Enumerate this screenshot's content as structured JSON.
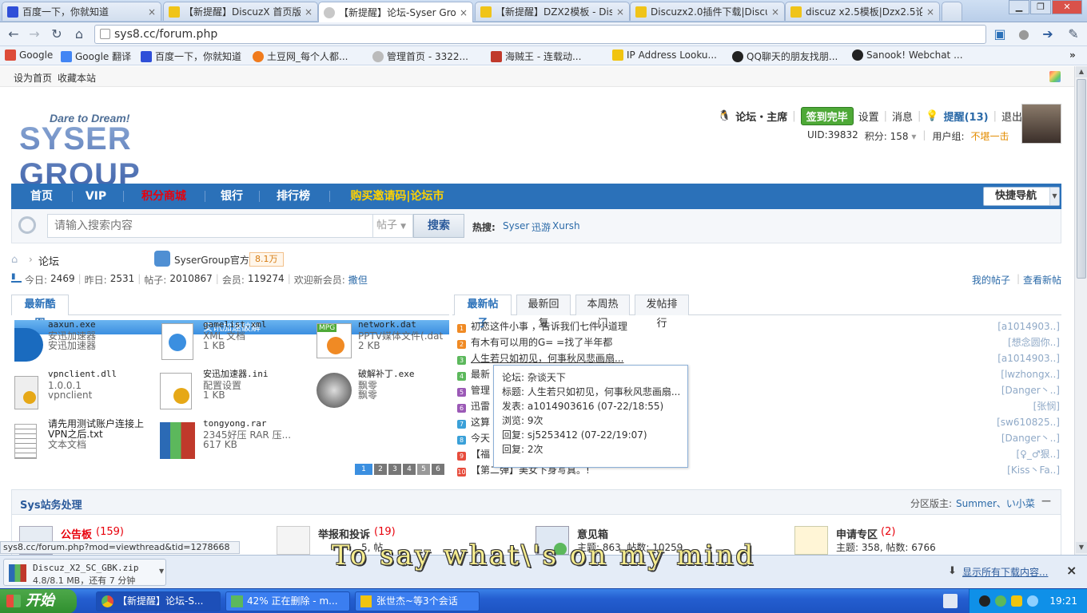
{
  "browser": {
    "tabs": [
      {
        "title": "百度一下，你就知道"
      },
      {
        "title": "【新提醒】DiscuzX 首页版..."
      },
      {
        "title": "【新提醒】论坛-Syser Gro..."
      },
      {
        "title": "【新提醒】DZX2模板 - Dis..."
      },
      {
        "title": "Discuzx2.0插件下载|Discu..."
      },
      {
        "title": "discuz x2.5模板|Dzx2.5论..."
      }
    ],
    "close_glyph": "×",
    "url": "sys8.cc/forum.php",
    "bookmarks": [
      "Google",
      "Google 翻译",
      "百度一下，你就知道",
      "土豆网_每个人都...",
      "管理首页 - 3322...",
      "海贼王 - 连载动...",
      "IP Address Looku...",
      "QQ聊天的朋友找朋...",
      "Sanook! Webchat ..."
    ],
    "status_url": "sys8.cc/forum.php?mod=viewthread&tid=1278668"
  },
  "site": {
    "top_links": [
      "设为首页",
      "收藏本站"
    ],
    "logo_tagline": "Dare to Dream!",
    "logo_name": "SYSER GROUP",
    "user_bar": {
      "forum_home": "论坛・主席",
      "signin": "签到完毕",
      "settings": "设置",
      "messages": "消息",
      "reminders": "提醒(13)",
      "logout": "退出",
      "uid": "UID:39832",
      "credits": "积分: 158",
      "usergroup_label": "用户组:",
      "usergroup": "不堪一击"
    },
    "nav": [
      "首页",
      "VIP",
      "积分商城",
      "银行",
      "排行榜",
      "购买邀请码|论坛市"
    ],
    "quick_nav": "快捷导航",
    "search": {
      "placeholder": "请输入搜索内容",
      "type": "帖子",
      "button": "搜索",
      "hot_label": "热搜:",
      "hot_terms": [
        "Syser",
        "迅游",
        "Xursh"
      ]
    },
    "breadcrumb": "论坛",
    "official": "SyserGroup官方",
    "official_count": "8.1万",
    "stats": {
      "today_label": "今日:",
      "today": "2469",
      "yesterday_label": "昨日:",
      "yesterday": "2531",
      "posts_label": "帖子:",
      "posts": "2010867",
      "members_label": "会员:",
      "members": "119274",
      "welcome_label": "欢迎新会员:",
      "welcome": "撒但"
    },
    "my_posts": "我的帖子",
    "new_posts": "查看新帖",
    "gallery_tab": "最新酷图",
    "gallery_caption": "安讯加速破解",
    "files": [
      {
        "name": "aaxun.exe",
        "l1": "安迅加速器",
        "l2": "安迅加速器"
      },
      {
        "name": "gamelist.xml",
        "l1": "XML 文档",
        "l2": "1 KB"
      },
      {
        "name": "network.dat",
        "l1": "PPTV媒体文件(.dat",
        "l2": "2 KB"
      },
      {
        "name": "vpnclient.dll",
        "l1": "1.0.0.1",
        "l2": "vpnclient"
      },
      {
        "name": "安迅加速器.ini",
        "l1": "配置设置",
        "l2": "1 KB"
      },
      {
        "name": "破解补丁.exe",
        "l1": "飘零",
        "l2": "飘零"
      },
      {
        "name": "请先用测试账户连接上VPN之后.txt",
        "l1": "文本文档",
        "l2": ""
      },
      {
        "name": "tongyong.rar",
        "l1": "2345好压 RAR 压...",
        "l2": "617 KB"
      }
    ],
    "mpg_badge": "MPG",
    "pager": [
      "1",
      "2",
      "3",
      "4",
      "5",
      "6"
    ],
    "post_tabs": [
      "最新帖子",
      "最新回复",
      "本周热门",
      "发帖排行"
    ],
    "posts": [
      {
        "n": "1",
        "title": "初恋这件小事 ，告诉我们七件小道理",
        "author": "[a1014903..]",
        "color": "#f08a24"
      },
      {
        "n": "2",
        "title": "有木有可以用的G= =找了半年都",
        "author": "[想念圆你..]",
        "color": "#f08a24"
      },
      {
        "n": "3",
        "title": "人生若只如初见，何事秋风悲画扇...",
        "author": "[a1014903..]",
        "color": "#f08a24"
      },
      {
        "n": "4",
        "title": "最新",
        "author": "[lwzhongx..]",
        "color": "#5cb85c"
      },
      {
        "n": "5",
        "title": "管理",
        "author": "[Danger丶..]",
        "color": "#9b59b6"
      },
      {
        "n": "6",
        "title": "迅雷",
        "author": "[张悯]",
        "color": "#9b59b6"
      },
      {
        "n": "7",
        "title": "这算",
        "author": "[sw610825..]",
        "color": "#3aa0d8"
      },
      {
        "n": "8",
        "title": "今天",
        "author": "[Danger丶..]",
        "color": "#3aa0d8"
      },
      {
        "n": "9",
        "title": "【福",
        "author": "[♀_♂狠..]",
        "color": "#e74c3c"
      },
      {
        "n": "10",
        "title": "【第二弹】美女下身写真。!",
        "author": "[Kiss丶Fa..]",
        "color": "#e74c3c"
      }
    ],
    "tooltip": {
      "forum": "论坛: 杂谈天下",
      "title": "标题: 人生若只如初见，何事秋风悲画扇...",
      "posted": "发表: a1014903616 (07-22/18:55)",
      "views": "浏览: 9次",
      "reply": "回复: sj5253412 (07-22/19:07)",
      "replies": "回复: 2次"
    },
    "section": {
      "title": "Sys站务处理",
      "mod_label": "分区版主:",
      "mods": "Summer、い小菜",
      "collapse": "—"
    },
    "forums": [
      {
        "name": "公告板",
        "count": "(159)",
        "stats": "5, 帖数: 13796"
      },
      {
        "name": "举报和投诉",
        "count": "(19)",
        "stats": ""
      },
      {
        "name": "意见箱",
        "count": "",
        "stats": "主题: 863, 帖数: 10259"
      },
      {
        "name": "申请专区",
        "count": "(2)",
        "stats": "主题: 358, 帖数: 6766"
      }
    ]
  },
  "download": {
    "file": "Discuz_X2_SC_GBK.zip",
    "progress": "4.8/8.1 MB，还有 7 分钟",
    "show_all": "显示所有下载内容...",
    "close": "×"
  },
  "subtitle": "To say what\\'s on my mind",
  "taskbar": {
    "start": "开始",
    "tasks": [
      "【新提醒】论坛-S...",
      "42% 正在删除 - m...",
      "张世杰~等3个会话"
    ],
    "clock": "19:21"
  },
  "colors": {
    "nav_blue": "#2b71b9",
    "accent_red": "#e8000b",
    "accent_gold": "#ffd200",
    "taskbar_blue": "#245ed0"
  }
}
